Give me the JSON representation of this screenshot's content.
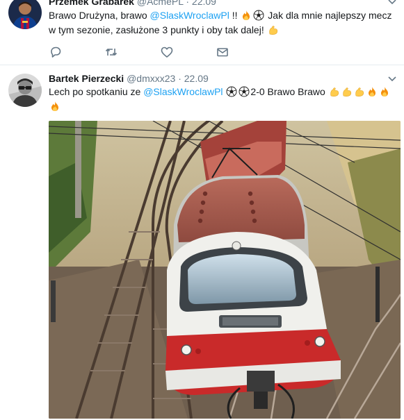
{
  "tweets": [
    {
      "name": "Przemek Grabarek",
      "handle": "@AcmePL",
      "separator": "·",
      "date": "22.09",
      "text_1": "Brawo Drużyna, brawo ",
      "mention_1": "@SlaskWroclawPl",
      "text_2": " !! ",
      "text_3": " Jak dla mnie najlepszy mecz w tym sezonie, zasłużone 3 punkty i oby tak dalej! ",
      "icons": {
        "avatar": "player-avatar",
        "caret": "chevron-down-icon",
        "emoji_1": "fire-emoji",
        "emoji_2": "soccer-ball-emoji",
        "emoji_3": "flexed-biceps-emoji"
      },
      "actions": [
        "reply-icon",
        "retweet-icon",
        "like-icon",
        "direct-message-icon"
      ]
    },
    {
      "name": "Bartek Pierzecki",
      "handle": "@dmxxx23",
      "separator": "·",
      "date": "22.09",
      "text_1": "Lech po spotkaniu ze ",
      "mention_1": "@SlaskWroclawPl",
      "text_2": " ",
      "text_3": "2-0 Brawo Brawo ",
      "icons": {
        "avatar": "man-with-glasses-avatar",
        "caret": "chevron-down-icon",
        "emoji_1": "soccer-ball-emoji",
        "emoji_2": "flexed-biceps-emoji",
        "emoji_3": "fire-emoji"
      },
      "photo": "derailed-red-white-train-photo"
    }
  ],
  "colors": {
    "link": "#1da1f2",
    "secondary_text": "#657786",
    "icon": "#657786",
    "divider": "#e6ecf0"
  }
}
